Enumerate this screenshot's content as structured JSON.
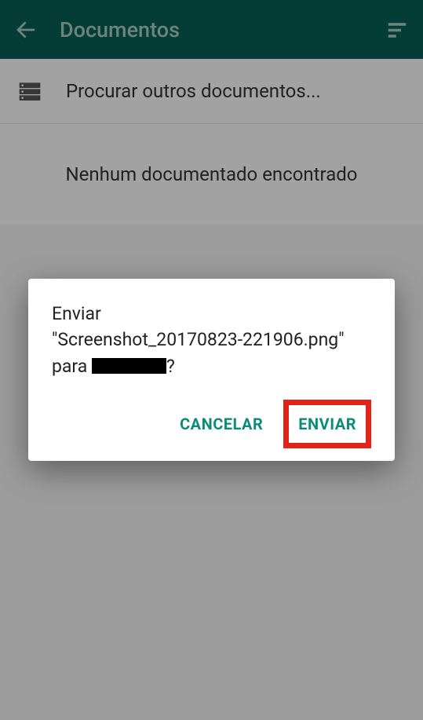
{
  "header": {
    "title": "Documentos"
  },
  "browse": {
    "label": "Procurar outros documentos..."
  },
  "empty": {
    "message": "Nenhum documentado encontrado"
  },
  "dialog": {
    "line1": "Enviar",
    "line2_prefix": "\"Screenshot_20170823-221906.png\"",
    "line3_prefix": "para ",
    "line3_suffix": "?",
    "cancel": "CANCELAR",
    "send": "ENVIAR"
  }
}
